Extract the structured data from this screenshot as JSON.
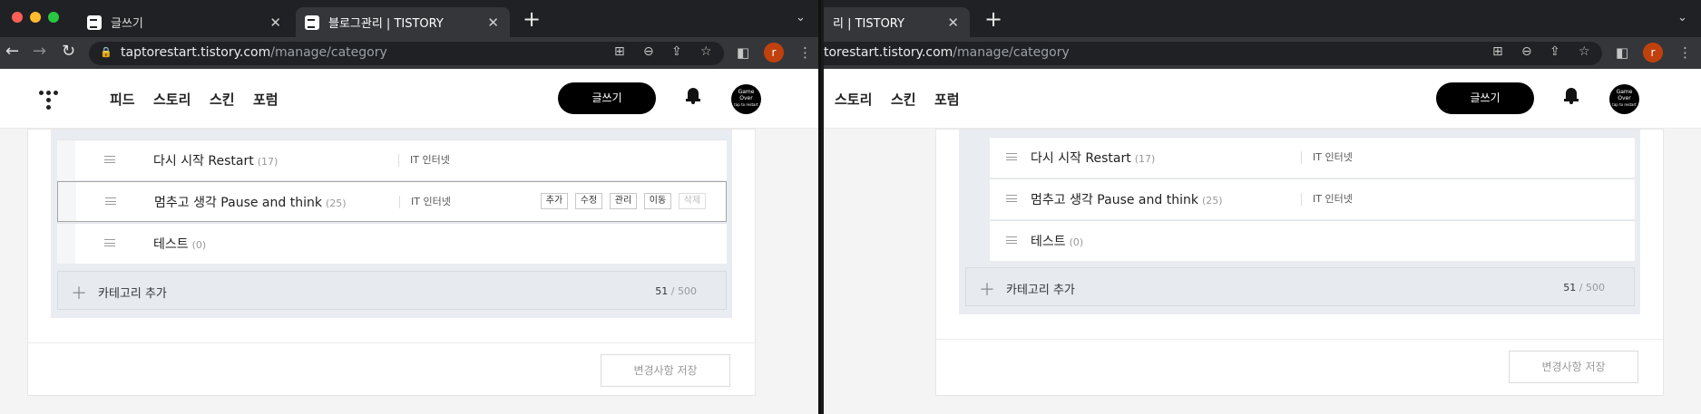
{
  "left": {
    "tabs": [
      {
        "label": "글쓰기"
      },
      {
        "label": "블로그관리 | TISTORY"
      }
    ],
    "url_host": "taptorestart.tistory.com",
    "url_path": "/manage/category",
    "avatar_letter": "r",
    "nav": [
      "피드",
      "스토리",
      "스킨",
      "포럼"
    ],
    "write_label": "글쓰기",
    "profile_text": "Game Over",
    "profile_sub": "tap to restart",
    "rows": [
      {
        "name": "다시 시작 Restart",
        "count": "(17)",
        "topic": "IT 인터넷"
      },
      {
        "name": "멈추고 생각 Pause and think",
        "count": "(25)",
        "topic": "IT 인터넷"
      },
      {
        "name": "테스트",
        "count": "(0)",
        "topic": ""
      }
    ],
    "actions": [
      "추가",
      "수정",
      "관리",
      "이동",
      "삭제"
    ],
    "add_category_label": "카테고리 추가",
    "count_used": "51",
    "count_max": "/ 500",
    "save_label": "변경사항 저장"
  },
  "right": {
    "tab_label": "리 | TISTORY",
    "url_host": "torestart.tistory.com",
    "url_path": "/manage/category",
    "avatar_letter": "r",
    "nav": [
      "스토리",
      "스킨",
      "포럼"
    ],
    "write_label": "글쓰기",
    "profile_text": "Game Over",
    "profile_sub": "tap to restart",
    "rows": [
      {
        "name": "다시 시작 Restart",
        "count": "(17)",
        "topic": "IT 인터넷"
      },
      {
        "name": "멈추고 생각 Pause and think",
        "count": "(25)",
        "topic": "IT 인터넷"
      },
      {
        "name": "테스트",
        "count": "(0)",
        "topic": ""
      }
    ],
    "add_category_label": "카테고리 추가",
    "count_used": "51",
    "count_max": "/ 500",
    "save_label": "변경사항 저장"
  },
  "icons": [
    "back-icon",
    "forward-icon",
    "reload-icon",
    "lock-icon",
    "translate-icon",
    "zoom-icon",
    "share-icon",
    "bookmark-star-icon",
    "sidepanel-icon",
    "more-icon",
    "bell-icon",
    "drag-handle-icon",
    "plus-icon"
  ],
  "colors": {
    "write_button": "#000000",
    "avatar": "#c1410d",
    "chrome_bg": "#202124"
  }
}
